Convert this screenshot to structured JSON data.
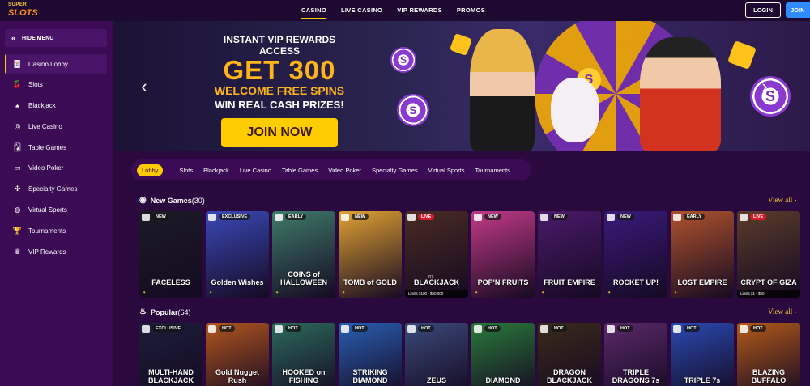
{
  "logo": {
    "line1": "SUPER",
    "line2": "SLOTS"
  },
  "nav": {
    "items": [
      "CASINO",
      "LIVE CASINO",
      "VIP REWARDS",
      "PROMOS"
    ],
    "active": "CASINO"
  },
  "header": {
    "login_label": "LOGIN",
    "join_label": "JOIN"
  },
  "sidebar": {
    "hide_label": "HIDE MENU",
    "items": [
      {
        "label": "Casino Lobby",
        "icon": "casino-lobby-icon",
        "glyph": "🃏",
        "active": true
      },
      {
        "label": "Slots",
        "icon": "cherries-icon",
        "glyph": "🍒"
      },
      {
        "label": "Blackjack",
        "icon": "spade-icon",
        "glyph": "♠"
      },
      {
        "label": "Live Casino",
        "icon": "dealer-icon",
        "glyph": "◎"
      },
      {
        "label": "Table Games",
        "icon": "cards-icon",
        "glyph": "🂡"
      },
      {
        "label": "Video Poker",
        "icon": "monitor-icon",
        "glyph": "▭"
      },
      {
        "label": "Specialty Games",
        "icon": "specialty-icon",
        "glyph": "✣"
      },
      {
        "label": "Virtual Sports",
        "icon": "ball-icon",
        "glyph": "◍"
      },
      {
        "label": "Tournaments",
        "icon": "trophy-icon",
        "glyph": "🏆"
      },
      {
        "label": "VIP Rewards",
        "icon": "crown-icon",
        "glyph": "♛"
      }
    ]
  },
  "banner": {
    "sub": "INSTANT VIP REWARDS ACCESS",
    "big": "GET 300",
    "mid": "WELCOME FREE SPINS",
    "win": "WIN REAL CASH PRIZES!",
    "cta": "JOIN NOW",
    "chip_symbol": "S"
  },
  "categories": [
    "Lobby",
    "Slots",
    "Blackjack",
    "Live Casino",
    "Table Games",
    "Video Poker",
    "Specialty Games",
    "Virtual Sports",
    "Tournaments"
  ],
  "new_games": {
    "title": "New Games",
    "count": "(30)",
    "view_all": "View all",
    "tiles": [
      {
        "name": "FACELESS",
        "badge": "NEW",
        "bg": "#1b1b24"
      },
      {
        "name": "Golden Wishes",
        "badge": "EXCLUSIVE",
        "bg": "#3a49b8"
      },
      {
        "name": "COINS of HALLOWEEN",
        "badge": "EARLY",
        "bg": "#3f7a6a"
      },
      {
        "name": "TOMB of GOLD",
        "badge": "NEW",
        "bg": "#e2a233"
      },
      {
        "name": "BLACKJACK",
        "badge": "LIVE",
        "bg": "#4a2c22",
        "count": "7/7",
        "limits": "Limits $100 - $50,000"
      },
      {
        "name": "POP'N FRUITS",
        "badge": "NEW",
        "bg": "#c23a86"
      },
      {
        "name": "FRUIT EMPIRE",
        "badge": "NEW",
        "bg": "#4a1a6a"
      },
      {
        "name": "ROCKET UP!",
        "badge": "NEW",
        "bg": "#3a1a7a"
      },
      {
        "name": "LOST EMPIRE",
        "badge": "EARLY",
        "bg": "#b0532e"
      },
      {
        "name": "CRYPT OF GIZA",
        "badge": "LIVE",
        "bg": "#5a3c2a",
        "limits": "Limits $1 - $50"
      }
    ]
  },
  "popular": {
    "title": "Popular",
    "count": "(64)",
    "view_all": "View all",
    "tiles": [
      {
        "name": "MULTI-HAND BLACKJACK",
        "badge": "EXCLUSIVE",
        "bg": "#1c1e3a"
      },
      {
        "name": "Gold Nugget Rush",
        "badge": "HOT",
        "bg": "#b3561f"
      },
      {
        "name": "HOOKED on FISHING",
        "badge": "HOT",
        "bg": "#2c6a5c"
      },
      {
        "name": "STRIKING DIAMOND",
        "badge": "HOT",
        "bg": "#2a5fb3"
      },
      {
        "name": "ZEUS",
        "badge": "HOT",
        "bg": "#3a4a7a"
      },
      {
        "name": "DIAMOND",
        "badge": "HOT",
        "bg": "#2a7a3a"
      },
      {
        "name": "DRAGON BLACKJACK",
        "badge": "HOT",
        "bg": "#3a2a1a"
      },
      {
        "name": "TRIPLE DRAGONS 7s",
        "badge": "HOT",
        "bg": "#5a2a6a"
      },
      {
        "name": "TRIPLE 7s",
        "badge": "HOT",
        "bg": "#2a4ab3"
      },
      {
        "name": "BLAZING BUFFALO",
        "badge": "HOT",
        "bg": "#b35a1a"
      }
    ]
  },
  "colors": {
    "accent": "#ffcc00",
    "sidebar": "#3b0c55",
    "background": "#2a0a3e",
    "join": "#2f8bff"
  }
}
